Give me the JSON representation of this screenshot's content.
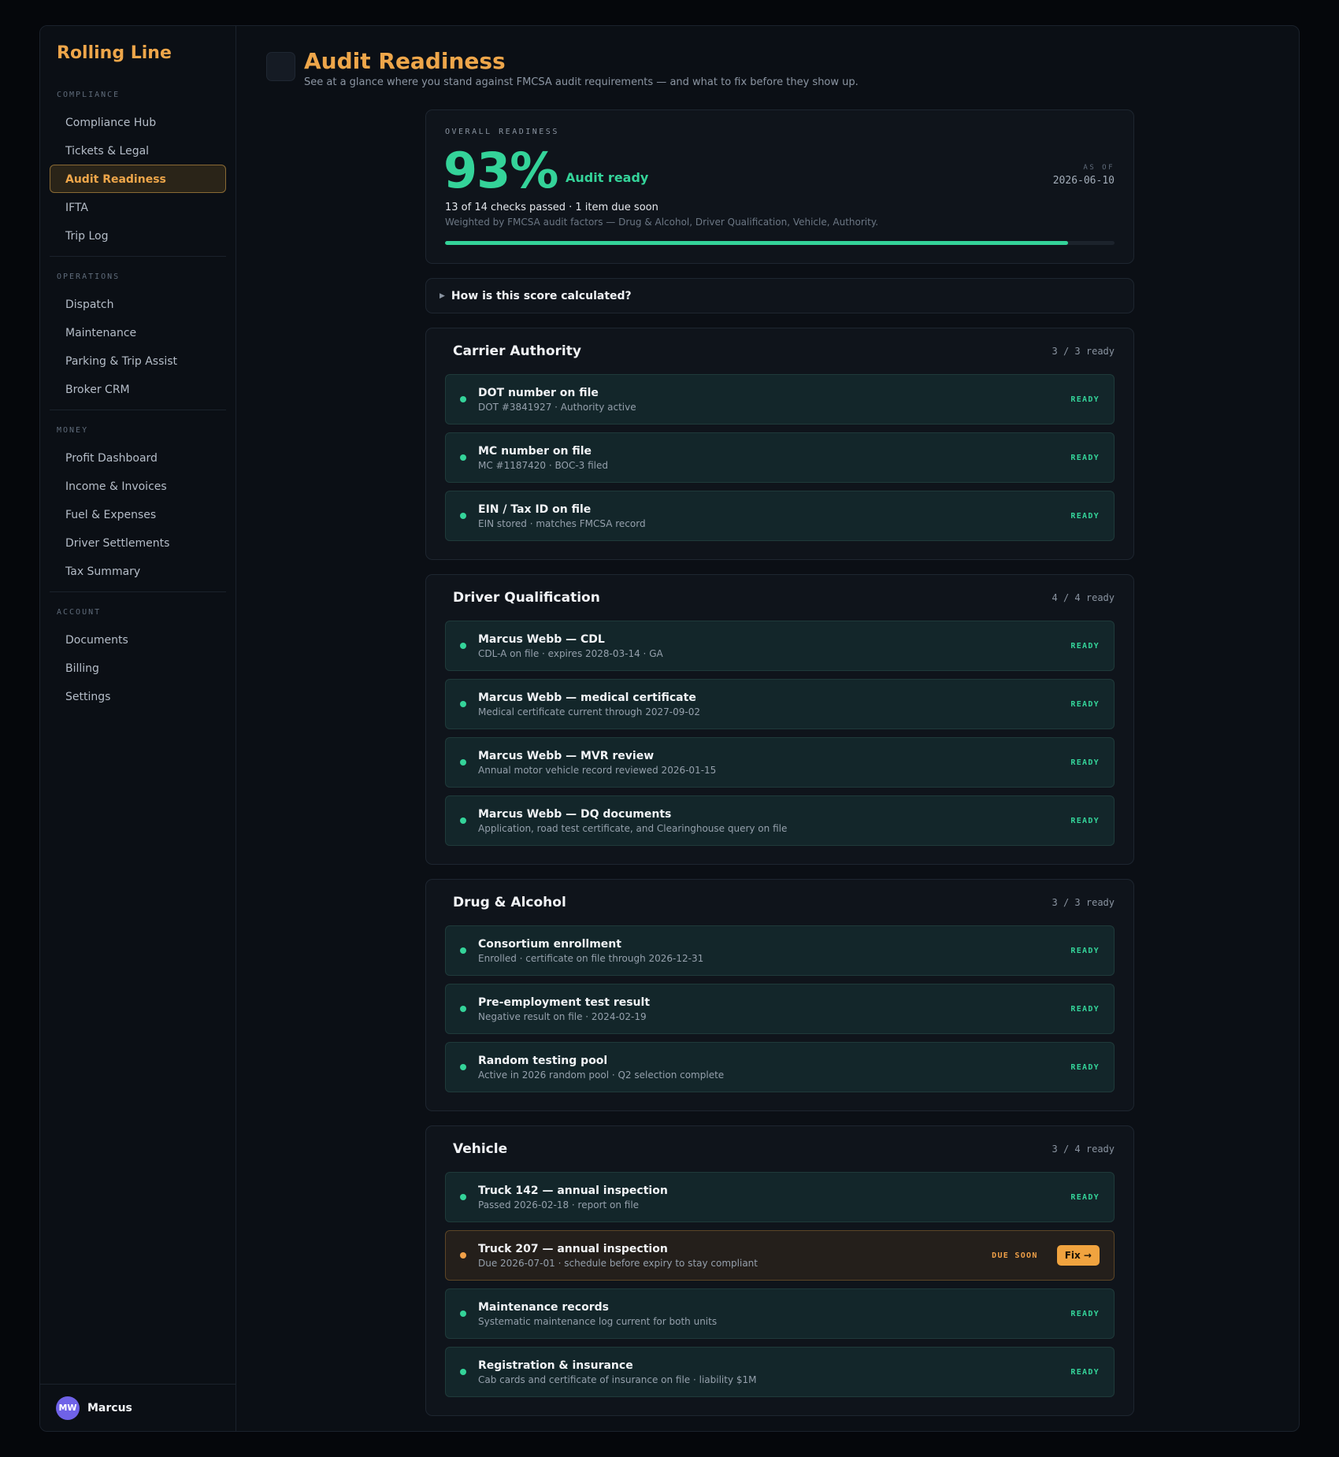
{
  "brand": "Rolling Line",
  "nav": {
    "compliance": {
      "label": "COMPLIANCE",
      "items": [
        "Compliance Hub",
        "Tickets & Legal",
        "Audit Readiness",
        "IFTA",
        "Trip Log"
      ]
    },
    "operations": {
      "label": "OPERATIONS",
      "items": [
        "Dispatch",
        "Maintenance",
        "Parking & Trip Assist",
        "Broker CRM"
      ]
    },
    "money": {
      "label": "MONEY",
      "items": [
        "Profit Dashboard",
        "Income & Invoices",
        "Fuel & Expenses",
        "Driver Settlements",
        "Tax Summary"
      ]
    },
    "account": {
      "label": "ACCOUNT",
      "items": [
        "Documents",
        "Billing",
        "Settings"
      ]
    },
    "active": "Audit Readiness"
  },
  "user": {
    "initials": "MW",
    "name": "Marcus",
    "avatar_color": "#6f62e8"
  },
  "page": {
    "title": "Audit Readiness",
    "subtitle": "See at a glance where you stand against FMCSA audit requirements — and what to fix before they show up."
  },
  "overall": {
    "label": "OVERALL READINESS",
    "percent_text": "93%",
    "percent": 93,
    "status": "Audit ready",
    "as_of_label": "AS OF",
    "as_of": "2026-06-10",
    "summary": "13 of 14 checks passed · 1 item due soon",
    "weighting": "Weighted by FMCSA audit factors — Drug & Alcohol, Driver Qualification, Vehicle, Authority."
  },
  "how_label": "How is this score calculated?",
  "groups": [
    {
      "title": "Carrier Authority",
      "count": "3 / 3 ready",
      "items": [
        {
          "title": "DOT number on file",
          "sub": "DOT #3841927 · Authority active",
          "status": "READY"
        },
        {
          "title": "MC number on file",
          "sub": "MC #1187420 · BOC-3 filed",
          "status": "READY"
        },
        {
          "title": "EIN / Tax ID on file",
          "sub": "EIN stored · matches FMCSA record",
          "status": "READY"
        }
      ]
    },
    {
      "title": "Driver Qualification",
      "count": "4 / 4 ready",
      "items": [
        {
          "title": "Marcus Webb — CDL",
          "sub": "CDL-A on file · expires 2028-03-14 · GA",
          "status": "READY"
        },
        {
          "title": "Marcus Webb — medical certificate",
          "sub": "Medical certificate current through 2027-09-02",
          "status": "READY"
        },
        {
          "title": "Marcus Webb — MVR review",
          "sub": "Annual motor vehicle record reviewed 2026-01-15",
          "status": "READY"
        },
        {
          "title": "Marcus Webb — DQ documents",
          "sub": "Application, road test certificate, and Clearinghouse query on file",
          "status": "READY"
        }
      ]
    },
    {
      "title": "Drug & Alcohol",
      "count": "3 / 3 ready",
      "items": [
        {
          "title": "Consortium enrollment",
          "sub": "Enrolled · certificate on file through 2026-12-31",
          "status": "READY"
        },
        {
          "title": "Pre-employment test result",
          "sub": "Negative result on file · 2024-02-19",
          "status": "READY"
        },
        {
          "title": "Random testing pool",
          "sub": "Active in 2026 random pool · Q2 selection complete",
          "status": "READY"
        }
      ]
    },
    {
      "title": "Vehicle",
      "count": "3 / 4 ready",
      "items": [
        {
          "title": "Truck 142 — annual inspection",
          "sub": "Passed 2026-02-18 · report on file",
          "status": "READY"
        },
        {
          "title": "Truck 207 — annual inspection",
          "sub": "Due 2026-07-01 · schedule before expiry to stay compliant",
          "status": "DUE SOON",
          "action": "Fix →",
          "warn": true
        },
        {
          "title": "Maintenance records",
          "sub": "Systematic maintenance log current for both units",
          "status": "READY"
        },
        {
          "title": "Registration & insurance",
          "sub": "Cab cards and certificate of insurance on file · liability $1M",
          "status": "READY"
        }
      ]
    }
  ],
  "colors": {
    "accent": "#eea64a",
    "ready": "#34d399",
    "warn": "#f0a048"
  }
}
